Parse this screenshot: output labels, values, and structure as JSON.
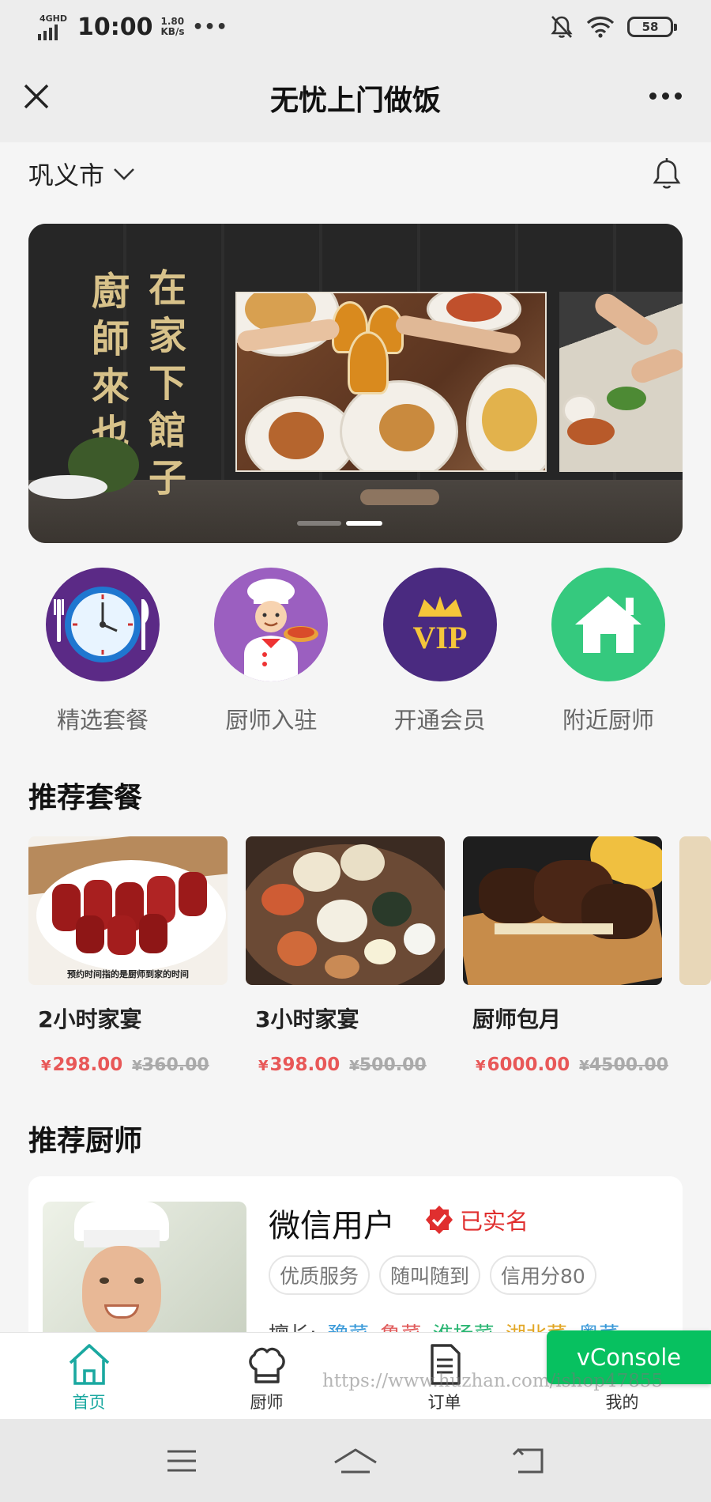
{
  "status_bar": {
    "network": "4GHD",
    "time": "10:00",
    "speed_value": "1.80",
    "speed_unit": "KB/s",
    "dots": "•••",
    "battery": "58"
  },
  "header": {
    "title": "无忧上门做饭"
  },
  "location": {
    "city": "巩义市"
  },
  "banner": {
    "slogan_right": [
      "在",
      "家",
      "下",
      "館",
      "子"
    ],
    "slogan_left": [
      "廚",
      "師",
      "來",
      "也"
    ],
    "active_slide": 2,
    "slide_count": 2
  },
  "categories": [
    {
      "label": "精选套餐",
      "icon": "clock-cutlery-icon",
      "color": "#5b2a86"
    },
    {
      "label": "厨师入驻",
      "icon": "chef-pizza-icon",
      "color": "#9b5fc0"
    },
    {
      "label": "开通会员",
      "icon": "vip-crown-icon",
      "color": "#4a2a80"
    },
    {
      "label": "附近厨师",
      "icon": "house-icon",
      "color": "#35c97e"
    }
  ],
  "sections": {
    "packages_title": "推荐套餐",
    "chefs_title": "推荐厨师"
  },
  "packages": [
    {
      "name": "2小时家宴",
      "price": "298.00",
      "old_price": "360.00",
      "currency": "¥",
      "image_caption": "预约时间指的是厨师到家的时间"
    },
    {
      "name": "3小时家宴",
      "price": "398.00",
      "old_price": "500.00",
      "currency": "¥"
    },
    {
      "name": "厨师包月",
      "price": "6000.00",
      "old_price": "4500.00",
      "currency": "¥"
    }
  ],
  "chef": {
    "name": "微信用户",
    "verified": "已实名",
    "tags": [
      "优质服务",
      "随叫随到",
      "信用分80"
    ],
    "skills_label": "擅长:",
    "skills": [
      {
        "name": "豫菜",
        "color": "#3a9ad9"
      },
      {
        "name": "鲁菜",
        "color": "#e05a5a"
      },
      {
        "name": "淮扬菜",
        "color": "#2bb673"
      },
      {
        "name": "湖北菜",
        "color": "#e2a623"
      },
      {
        "name": "粤菜",
        "color": "#3a9ad9"
      }
    ]
  },
  "tabbar": {
    "items": [
      {
        "label": "首页",
        "icon": "home-icon",
        "active": true
      },
      {
        "label": "厨师",
        "icon": "chef-hat-icon",
        "active": false
      },
      {
        "label": "订单",
        "icon": "document-icon",
        "active": false
      },
      {
        "label": "我的",
        "icon": "user-icon",
        "active": false
      }
    ],
    "active_color": "#1aa8a0"
  },
  "overlay": {
    "vconsole": "vConsole",
    "watermark": "https://www.huzhan.com/ishop47855"
  }
}
